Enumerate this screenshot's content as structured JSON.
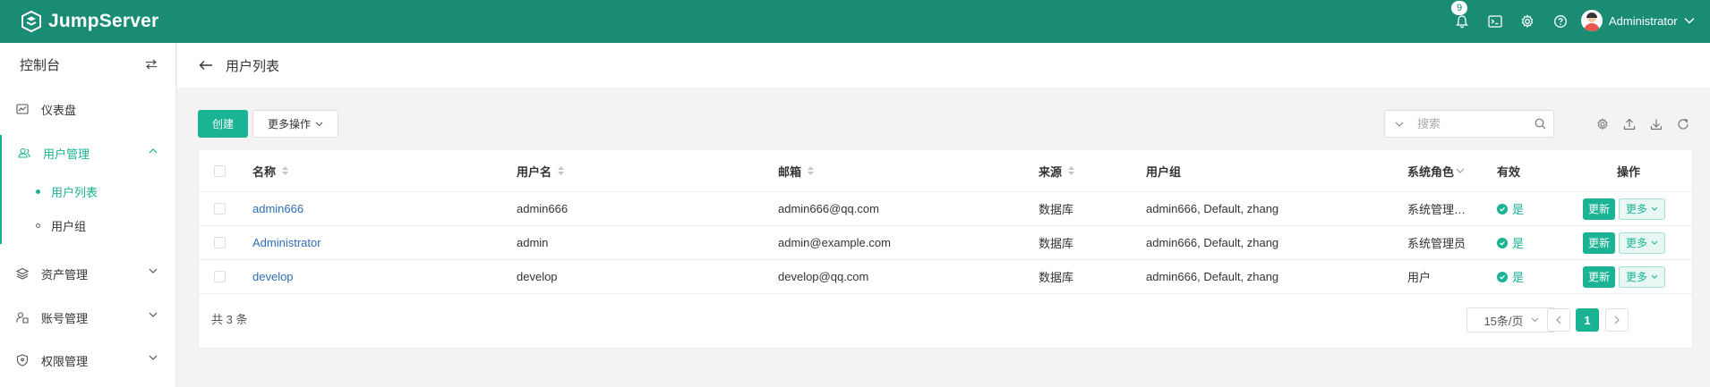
{
  "app": {
    "name": "JumpServer"
  },
  "topbar": {
    "notification_count": "9",
    "user_name": "Administrator"
  },
  "sidebar": {
    "title": "控制台",
    "items": [
      {
        "label": "仪表盘"
      },
      {
        "label": "用户管理",
        "children": [
          {
            "label": "用户列表"
          },
          {
            "label": "用户组"
          }
        ]
      },
      {
        "label": "资产管理"
      },
      {
        "label": "账号管理"
      },
      {
        "label": "权限管理"
      }
    ]
  },
  "page": {
    "title": "用户列表"
  },
  "toolbar": {
    "create_label": "创建",
    "more_actions_label": "更多操作",
    "search_placeholder": "搜索"
  },
  "table": {
    "columns": [
      "名称",
      "用户名",
      "邮箱",
      "来源",
      "用户组",
      "系统角色",
      "有效",
      "操作"
    ],
    "rows": [
      {
        "name": "admin666",
        "username": "admin666",
        "email": "admin666@qq.com",
        "source": "数据库",
        "groups": "admin666, Default, zhang",
        "role": "系统管理…",
        "active": "是"
      },
      {
        "name": "Administrator",
        "username": "admin",
        "email": "admin@example.com",
        "source": "数据库",
        "groups": "admin666, Default, zhang",
        "role": "系统管理员",
        "active": "是"
      },
      {
        "name": "develop",
        "username": "develop",
        "email": "develop@qq.com",
        "source": "数据库",
        "groups": "admin666, Default, zhang",
        "role": "用户",
        "active": "是"
      }
    ],
    "update_label": "更新",
    "more_label": "更多"
  },
  "pagination": {
    "total_text": "共 3 条",
    "page_size": "15条/页",
    "current_page": "1"
  },
  "colors": {
    "brand": "#1a8c74",
    "accent": "#1ab394",
    "link": "#2f6eb5"
  }
}
